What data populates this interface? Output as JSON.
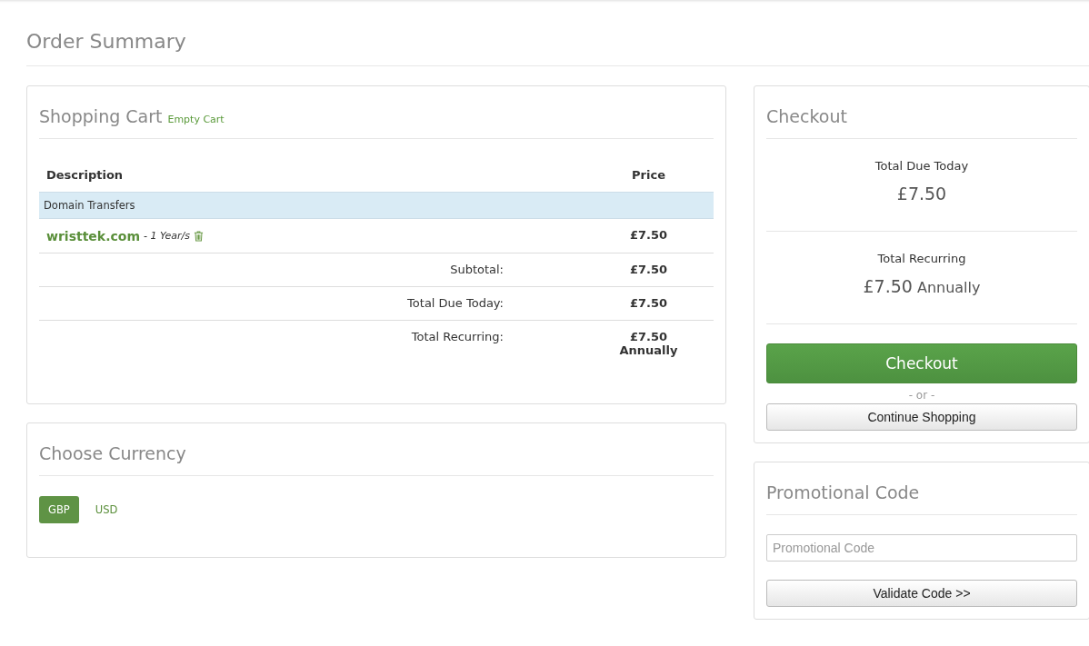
{
  "page_title": "Order Summary",
  "cart": {
    "title": "Shopping Cart",
    "empty_link": "Empty Cart",
    "columns": [
      "Description",
      "Price"
    ],
    "groups": [
      {
        "name": "Domain Transfers",
        "items": [
          {
            "domain": "wristtek.com",
            "term": "- 1 Year/s",
            "price": "£7.50"
          }
        ]
      }
    ],
    "totals": [
      {
        "label": "Subtotal:",
        "value": "£7.50"
      },
      {
        "label": "Total Due Today:",
        "value": "£7.50"
      },
      {
        "label": "Total Recurring:",
        "value": "£7.50",
        "period": "Annually"
      }
    ]
  },
  "currency": {
    "title": "Choose Currency",
    "options": [
      {
        "label": "GBP",
        "selected": true
      },
      {
        "label": "USD",
        "selected": false
      }
    ]
  },
  "checkout": {
    "title": "Checkout",
    "due_label": "Total Due Today",
    "due_value": "£7.50",
    "recurring_label": "Total Recurring",
    "recurring_value": "£7.50",
    "recurring_period": "Annually",
    "checkout_button": "Checkout",
    "or_text": "- or -",
    "continue_button": "Continue Shopping"
  },
  "promo": {
    "title": "Promotional Code",
    "placeholder": "Promotional Code",
    "button": "Validate Code >>"
  }
}
